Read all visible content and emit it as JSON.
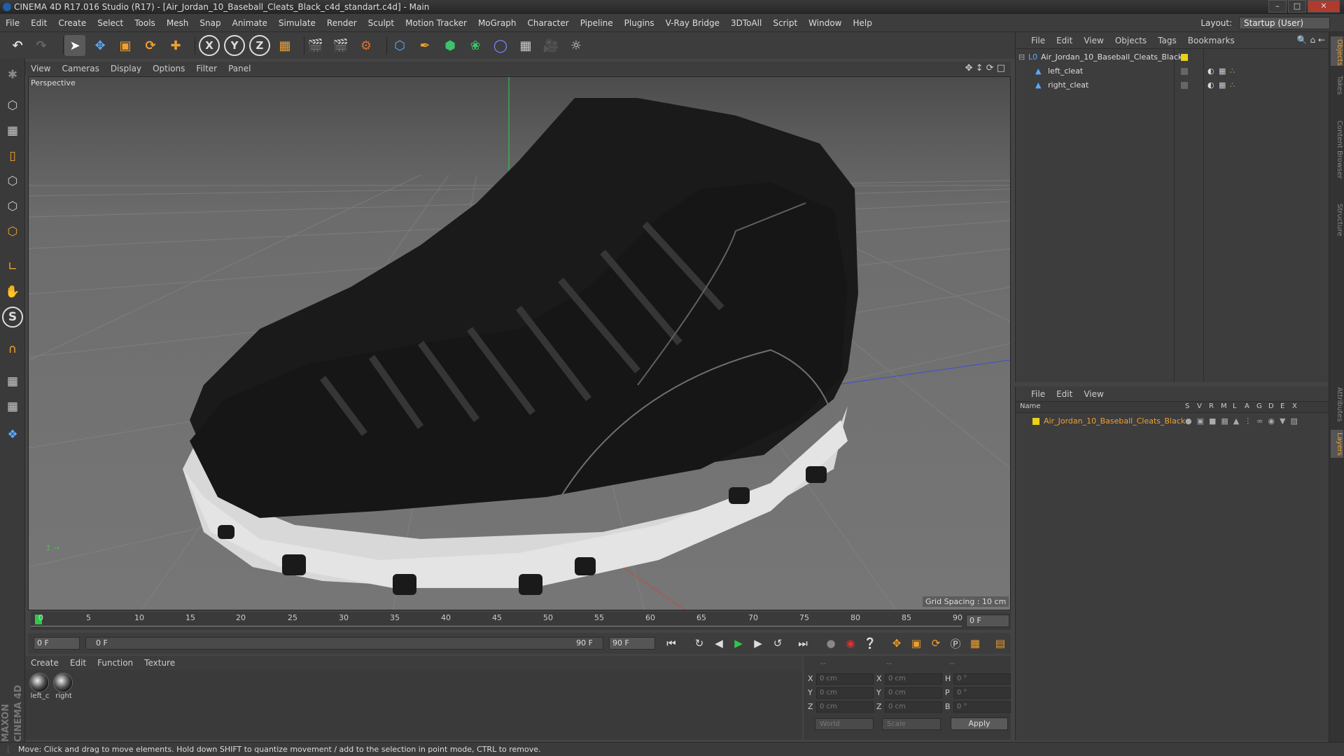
{
  "window": {
    "title": "CINEMA 4D R17.016 Studio (R17) - [Air_Jordan_10_Baseball_Cleats_Black_c4d_standart.c4d] - Main"
  },
  "menubar": {
    "items": [
      "File",
      "Edit",
      "Create",
      "Select",
      "Tools",
      "Mesh",
      "Snap",
      "Animate",
      "Simulate",
      "Render",
      "Sculpt",
      "Motion Tracker",
      "MoGraph",
      "Character",
      "Pipeline",
      "Plugins",
      "V-Ray Bridge",
      "3DToAll",
      "Script",
      "Window",
      "Help"
    ],
    "layout_label": "Layout:",
    "layout_value": "Startup (User)"
  },
  "toolbar": {
    "x_label": "X",
    "y_label": "Y",
    "z_label": "Z"
  },
  "viewport": {
    "menu": [
      "View",
      "Cameras",
      "Display",
      "Options",
      "Filter",
      "Panel"
    ],
    "camera_label": "Perspective",
    "grid_spacing": "Grid Spacing : 10 cm"
  },
  "timeline": {
    "ticks": [
      "0",
      "5",
      "10",
      "15",
      "20",
      "25",
      "30",
      "35",
      "40",
      "45",
      "50",
      "55",
      "60",
      "65",
      "70",
      "75",
      "80",
      "85",
      "90"
    ],
    "end_field": "0 F"
  },
  "playbar": {
    "current_frame": "0 F",
    "range_start": "0 F",
    "range_end": "90 F",
    "max_frame": "90 F"
  },
  "materials": {
    "menu": [
      "Create",
      "Edit",
      "Function",
      "Texture"
    ],
    "items": [
      {
        "name": "left_c"
      },
      {
        "name": "right"
      }
    ]
  },
  "coords": {
    "headers": [
      "--",
      "--",
      "--"
    ],
    "x_label": "X",
    "y_label": "Y",
    "z_label": "Z",
    "h_label": "H",
    "p_label": "P",
    "b_label": "B",
    "pos_x": "0 cm",
    "pos_y": "0 cm",
    "pos_z": "0 cm",
    "size_x": "0 cm",
    "size_y": "0 cm",
    "size_z": "0 cm",
    "rot_h": "0 °",
    "rot_p": "0 °",
    "rot_b": "0 °",
    "mode": "World",
    "transform": "Scale",
    "apply": "Apply"
  },
  "objects": {
    "menu": [
      "File",
      "Edit",
      "View",
      "Objects",
      "Tags",
      "Bookmarks"
    ],
    "items": [
      {
        "name": "Air_Jordan_10_Baseball_Cleats_Black"
      },
      {
        "name": "left_cleat"
      },
      {
        "name": "right_cleat"
      }
    ]
  },
  "layers": {
    "menu": [
      "File",
      "Edit",
      "View"
    ],
    "header": {
      "name": "Name",
      "cols": [
        "S",
        "V",
        "R",
        "M",
        "L",
        "A",
        "G",
        "D",
        "E",
        "X"
      ]
    },
    "items": [
      {
        "name": "Air_Jordan_10_Baseball_Cleats_Black",
        "color": "#e8d21a"
      }
    ]
  },
  "right_tabs": [
    "Objects",
    "Takes",
    "Content Browser",
    "Structure",
    "Attributes",
    "Layers"
  ],
  "maxon_logo": "MAXON CINEMA 4D",
  "status": "Move: Click and drag to move elements. Hold down SHIFT to quantize movement / add to the selection in point mode, CTRL to remove."
}
